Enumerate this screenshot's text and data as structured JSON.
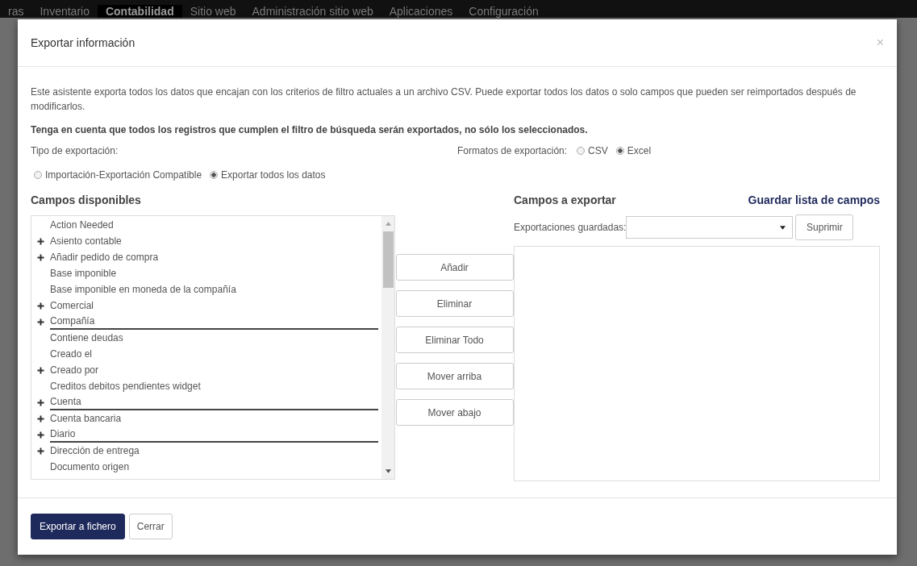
{
  "top_menu": [
    {
      "label": "ras",
      "selected": false
    },
    {
      "label": "Inventario",
      "selected": false
    },
    {
      "label": "Contabilidad",
      "selected": true
    },
    {
      "label": "Sitio web",
      "selected": false
    },
    {
      "label": "Administración sitio web",
      "selected": false
    },
    {
      "label": "Aplicaciones",
      "selected": false
    },
    {
      "label": "Configuración",
      "selected": false
    }
  ],
  "dialog": {
    "title": "Exportar información",
    "close": "×",
    "intro": "Este asistente exporta todos los datos que encajan con los criterios de filtro actuales a un archivo CSV. Puede exportar todos los datos o solo campos que pueden ser reimportados después de modificarlos.",
    "warning": "Tenga en cuenta que todos los registros que cumplen el filtro de búsqueda serán exportados, no sólo los seleccionados.",
    "export_type": {
      "label": "Tipo de exportación:",
      "options": [
        {
          "label": "Importación-Exportación Compatible",
          "selected": false
        },
        {
          "label": "Exportar todos los datos",
          "selected": true
        }
      ]
    },
    "formats": {
      "label": "Formatos de exportación:",
      "options": [
        {
          "label": "CSV",
          "selected": false
        },
        {
          "label": "Excel",
          "selected": true
        }
      ]
    },
    "available": {
      "heading": "Campos disponibles",
      "items": [
        {
          "label": "Action Needed",
          "expandable": false,
          "underlined": false
        },
        {
          "label": "Asiento contable",
          "expandable": true,
          "underlined": false
        },
        {
          "label": "Añadir pedido de compra",
          "expandable": true,
          "underlined": false
        },
        {
          "label": "Base imponible",
          "expandable": false,
          "underlined": false
        },
        {
          "label": "Base imponible en moneda de la compañía",
          "expandable": false,
          "underlined": false
        },
        {
          "label": "Comercial",
          "expandable": true,
          "underlined": false
        },
        {
          "label": "Compañía",
          "expandable": true,
          "underlined": true
        },
        {
          "label": "Contiene deudas",
          "expandable": false,
          "underlined": false
        },
        {
          "label": "Creado el",
          "expandable": false,
          "underlined": false
        },
        {
          "label": "Creado por",
          "expandable": true,
          "underlined": false
        },
        {
          "label": "Creditos debitos pendientes widget",
          "expandable": false,
          "underlined": false
        },
        {
          "label": "Cuenta",
          "expandable": true,
          "underlined": true
        },
        {
          "label": "Cuenta bancaria",
          "expandable": true,
          "underlined": false
        },
        {
          "label": "Diario",
          "expandable": true,
          "underlined": true
        },
        {
          "label": "Dirección de entrega",
          "expandable": true,
          "underlined": false
        },
        {
          "label": "Documento origen",
          "expandable": false,
          "underlined": false
        }
      ]
    },
    "actions": [
      "Añadir",
      "Eliminar",
      "Eliminar Todo",
      "Mover arriba",
      "Mover abajo"
    ],
    "to_export": {
      "heading": "Campos a exportar",
      "save_link": "Guardar lista de campos",
      "saved_label": "Exportaciones guardadas:",
      "delete_button": "Suprimir"
    },
    "footer": {
      "primary": "Exportar a fichero",
      "secondary": "Cerrar"
    }
  }
}
